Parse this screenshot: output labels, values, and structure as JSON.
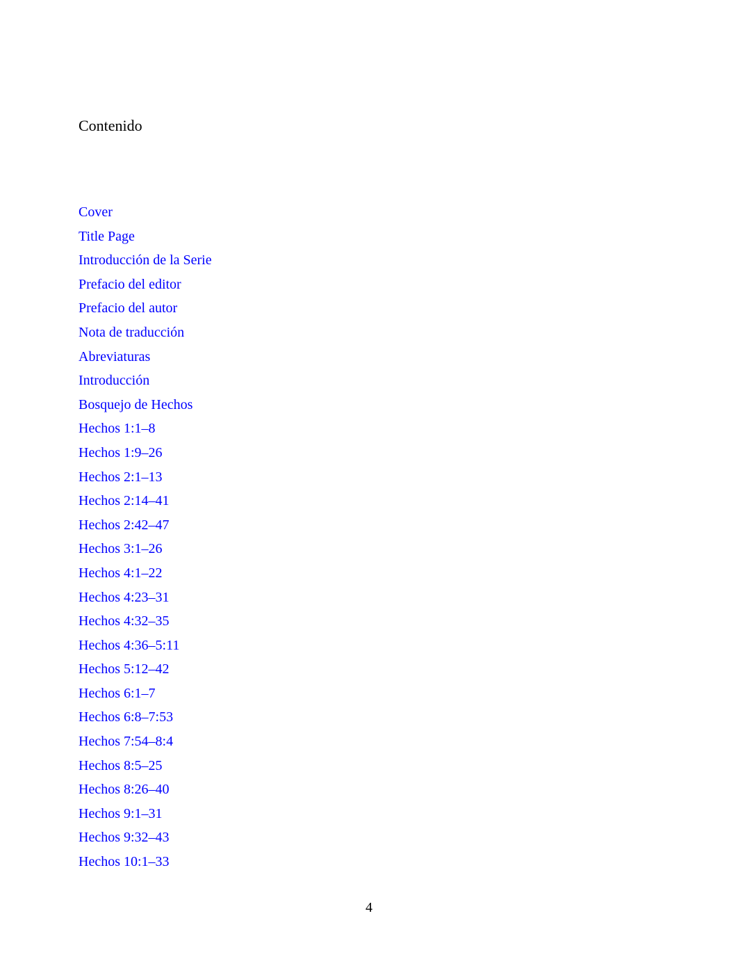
{
  "page": {
    "heading": "Contenido",
    "page_number": "4",
    "link_color": "#0000ff",
    "text_color": "#000000",
    "background_color": "#ffffff"
  },
  "toc": {
    "items": [
      {
        "label": "Cover"
      },
      {
        "label": "Title Page"
      },
      {
        "label": "Introducción de la Serie"
      },
      {
        "label": "Prefacio del editor"
      },
      {
        "label": "Prefacio del autor"
      },
      {
        "label": "Nota de traducción"
      },
      {
        "label": "Abreviaturas"
      },
      {
        "label": "Introducción"
      },
      {
        "label": "Bosquejo de Hechos"
      },
      {
        "label": "Hechos 1:1–8"
      },
      {
        "label": "Hechos 1:9–26"
      },
      {
        "label": "Hechos 2:1–13"
      },
      {
        "label": "Hechos 2:14–41"
      },
      {
        "label": "Hechos 2:42–47"
      },
      {
        "label": "Hechos 3:1–26"
      },
      {
        "label": "Hechos 4:1–22"
      },
      {
        "label": "Hechos 4:23–31"
      },
      {
        "label": "Hechos 4:32–35"
      },
      {
        "label": "Hechos 4:36–5:11"
      },
      {
        "label": "Hechos 5:12–42"
      },
      {
        "label": "Hechos 6:1–7"
      },
      {
        "label": "Hechos 6:8–7:53"
      },
      {
        "label": "Hechos 7:54–8:4"
      },
      {
        "label": "Hechos 8:5–25"
      },
      {
        "label": "Hechos 8:26–40"
      },
      {
        "label": "Hechos 9:1–31"
      },
      {
        "label": "Hechos 9:32–43"
      },
      {
        "label": "Hechos 10:1–33"
      }
    ]
  }
}
